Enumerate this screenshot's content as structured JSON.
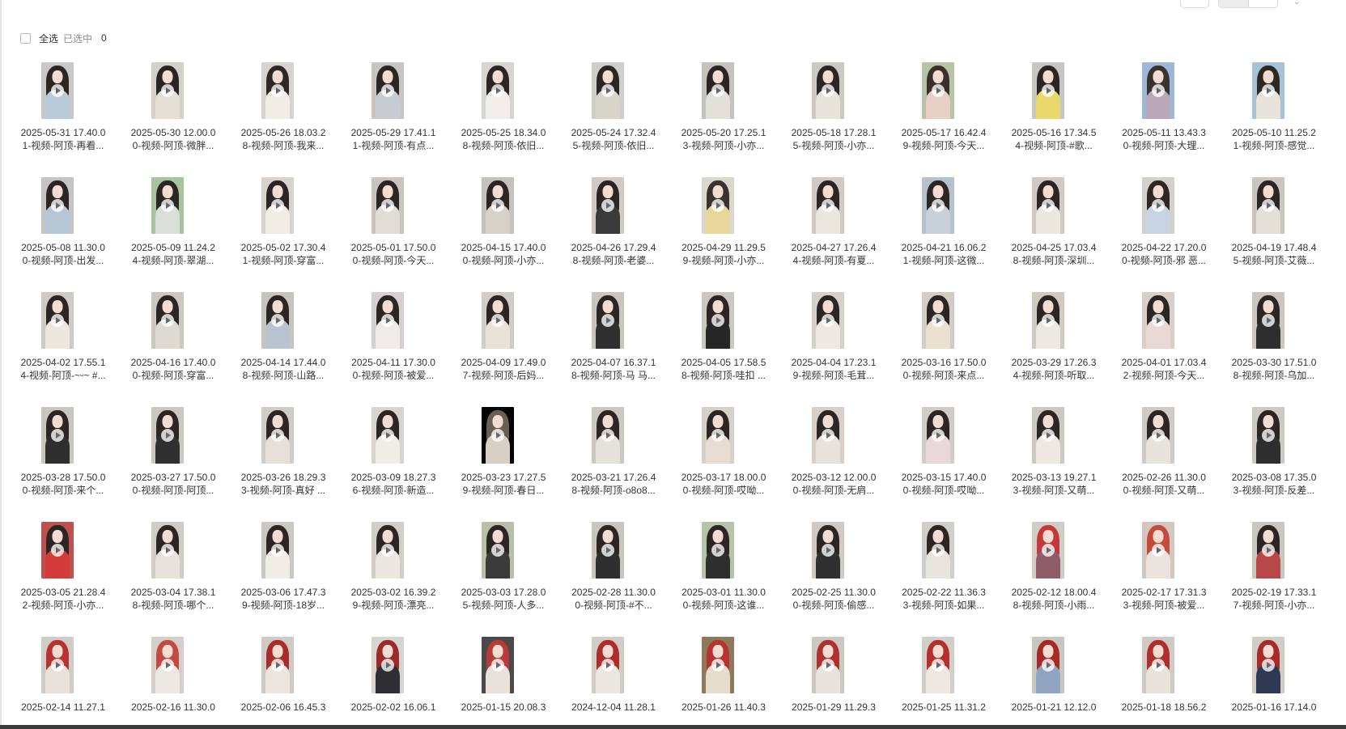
{
  "toolbar": {
    "select_all": "全选",
    "selected_label": "已选中",
    "selected_count": "0"
  },
  "items": [
    {
      "line1": "2025-05-31 17.40.0",
      "line2": "1-视频-阿顶-再看...",
      "bg": "#c8c8c8",
      "hair": "#2b2623",
      "body": "#b9cbd8"
    },
    {
      "line1": "2025-05-30 12.00.0",
      "line2": "0-视频-阿顶-微胖...",
      "bg": "#d5d1cb",
      "hair": "#2a2522",
      "body": "#e6dfd6"
    },
    {
      "line1": "2025-05-26 18.03.2",
      "line2": "8-视频-阿顶-我来...",
      "bg": "#d8d3cc",
      "hair": "#2e2824",
      "body": "#f0ece6"
    },
    {
      "line1": "2025-05-29 17.41.1",
      "line2": "1-视频-阿顶-有点...",
      "bg": "#c9c6c1",
      "hair": "#2b2623",
      "body": "#c7ccd2"
    },
    {
      "line1": "2025-05-25 18.34.0",
      "line2": "8-视频-阿顶-依旧...",
      "bg": "#d9d6d0",
      "hair": "#2b2623",
      "body": "#f2efea"
    },
    {
      "line1": "2025-05-24 17.32.4",
      "line2": "5-视频-阿顶-依旧...",
      "bg": "#cfcfc9",
      "hair": "#2b2623",
      "body": "#d8d4c8"
    },
    {
      "line1": "2025-05-20 17.25.1",
      "line2": "3-视频-阿顶-小亦...",
      "bg": "#c5c2bc",
      "hair": "#2a2522",
      "body": "#e3e0da"
    },
    {
      "line1": "2025-05-18 17.28.1",
      "line2": "5-视频-阿顶-小亦...",
      "bg": "#ccc9c3",
      "hair": "#2b2623",
      "body": "#e8e4dc"
    },
    {
      "line1": "2025-05-17 16.42.4",
      "line2": "9-视频-阿顶-今天...",
      "bg": "#b8c4a8",
      "hair": "#3a2f2a",
      "body": "#e6cfc4"
    },
    {
      "line1": "2025-05-16 17.34.5",
      "line2": "4-视频-阿顶-#歌...",
      "bg": "#c8c6c2",
      "hair": "#2b2623",
      "body": "#e8d96a"
    },
    {
      "line1": "2025-05-11 13.43.3",
      "line2": "0-视频-阿顶-大理...",
      "bg": "#9fb7d6",
      "hair": "#3a322d",
      "body": "#b8a8b8"
    },
    {
      "line1": "2025-05-10 11.25.2",
      "line2": "1-视频-阿顶-感觉...",
      "bg": "#a8c2d8",
      "hair": "#2e2824",
      "body": "#e8e4dc"
    },
    {
      "line1": "2025-05-08 11.30.0",
      "line2": "0-视频-阿顶-出发...",
      "bg": "#c4c4c4",
      "hair": "#2b2623",
      "body": "#b5c6d6"
    },
    {
      "line1": "2025-05-09 11.24.2",
      "line2": "4-视频-阿顶-翠湖...",
      "bg": "#a7c3a0",
      "hair": "#2b2623",
      "body": "#d8e0d8"
    },
    {
      "line1": "2025-05-02 17.30.4",
      "line2": "1-视频-阿顶-穿富...",
      "bg": "#d8d3cc",
      "hair": "#2b2623",
      "body": "#f0ece6"
    },
    {
      "line1": "2025-05-01 17.50.0",
      "line2": "0-视频-阿顶-今天...",
      "bg": "#c8c5be",
      "hair": "#2b2623",
      "body": "#e0ddd6"
    },
    {
      "line1": "2025-04-15 17.40.0",
      "line2": "0-视频-阿顶-小亦...",
      "bg": "#c4c2bc",
      "hair": "#2b2623",
      "body": "#d6d2c8"
    },
    {
      "line1": "2025-04-26 17.29.4",
      "line2": "8-视频-阿顶-老婆...",
      "bg": "#cfcbc4",
      "hair": "#2b2623",
      "body": "#3a3a3a"
    },
    {
      "line1": "2025-04-29 11.29.5",
      "line2": "9-视频-阿顶-小亦...",
      "bg": "#d8d8cc",
      "hair": "#3a322d",
      "body": "#e8d79a"
    },
    {
      "line1": "2025-04-27 17.26.4",
      "line2": "4-视频-阿顶-有夏...",
      "bg": "#cfcbc4",
      "hair": "#2b2623",
      "body": "#ebe6de"
    },
    {
      "line1": "2025-04-21 16.06.2",
      "line2": "1-视频-阿顶-这微...",
      "bg": "#b7c1cc",
      "hair": "#2b2623",
      "body": "#c8d0da"
    },
    {
      "line1": "2025-04-25 17.03.4",
      "line2": "8-视频-阿顶-深圳...",
      "bg": "#cfcbc4",
      "hair": "#2b2623",
      "body": "#ece8e0"
    },
    {
      "line1": "2025-04-22 17.20.0",
      "line2": "0-视频-阿顶-邪 恶...",
      "bg": "#d2d0ca",
      "hair": "#2e2824",
      "body": "#c8d4e4"
    },
    {
      "line1": "2025-04-19 17.48.4",
      "line2": "5-视频-阿顶-艾薇...",
      "bg": "#c9c6c0",
      "hair": "#2b2623",
      "body": "#e4e0d8"
    },
    {
      "line1": "2025-04-02 17.55.1",
      "line2": "4-视频-阿顶-~ᵕ~ #...",
      "bg": "#cfcbc4",
      "hair": "#2b2623",
      "body": "#ece8e0"
    },
    {
      "line1": "2025-04-16 17.40.0",
      "line2": "0-视频-阿顶-穿富...",
      "bg": "#cbc8c2",
      "hair": "#2b2623",
      "body": "#dedad2"
    },
    {
      "line1": "2025-04-14 17.44.0",
      "line2": "8-视频-阿顶-山路...",
      "bg": "#c6c4be",
      "hair": "#2b2623",
      "body": "#b8c4d0"
    },
    {
      "line1": "2025-04-11 17.30.0",
      "line2": "0-视频-阿顶-被爱...",
      "bg": "#d8cfd0",
      "hair": "#2b2623",
      "body": "#f0ebe6"
    },
    {
      "line1": "2025-04-09 17.49.0",
      "line2": "7-视频-阿顶-后妈...",
      "bg": "#d0ccc6",
      "hair": "#2b2623",
      "body": "#e8e2d8"
    },
    {
      "line1": "2025-04-07 16.37.1",
      "line2": "8-视频-阿顶-马 马...",
      "bg": "#c9c6c0",
      "hair": "#2b2623",
      "body": "#2f2f2f"
    },
    {
      "line1": "2025-04-05 17.58.5",
      "line2": "8-视频-阿顶-哇扣 ...",
      "bg": "#cbc8c2",
      "hair": "#2b2623",
      "body": "#262626"
    },
    {
      "line1": "2025-04-04 17.23.1",
      "line2": "9-视频-阿顶-毛茸...",
      "bg": "#d4d0ca",
      "hair": "#2b2623",
      "body": "#efe8e2"
    },
    {
      "line1": "2025-03-16 17.50.0",
      "line2": "0-视频-阿顶-来点...",
      "bg": "#d2ccc4",
      "hair": "#2b2623",
      "body": "#ece0d0"
    },
    {
      "line1": "2025-03-29 17.26.3",
      "line2": "4-视频-阿顶-听取...",
      "bg": "#cfcac2",
      "hair": "#2b2623",
      "body": "#eee8e2"
    },
    {
      "line1": "2025-04-01 17.03.4",
      "line2": "2-视频-阿顶-今天...",
      "bg": "#d8cfc8",
      "hair": "#2b2623",
      "body": "#ead8d4"
    },
    {
      "line1": "2025-03-30 17.51.0",
      "line2": "8-视频-阿顶-乌加...",
      "bg": "#cbc7c0",
      "hair": "#2b2623",
      "body": "#2e2e2e"
    },
    {
      "line1": "2025-03-28 17.50.0",
      "line2": "0-视频-阿顶-来个...",
      "bg": "#c9c6c0",
      "hair": "#2b2623",
      "body": "#2e2e2e"
    },
    {
      "line1": "2025-03-27 17.50.0",
      "line2": "0-视频-阿顶-阿顶...",
      "bg": "#cbc8c2",
      "hair": "#2b2623",
      "body": "#303030"
    },
    {
      "line1": "2025-03-26 18.29.3",
      "line2": "3-视频-阿顶-真好 ...",
      "bg": "#d0ccc6",
      "hair": "#2b2623",
      "body": "#e6e0d8"
    },
    {
      "line1": "2025-03-09 18.27.3",
      "line2": "6-视频-阿顶-新造...",
      "bg": "#d8d4cf",
      "hair": "#2b2623",
      "body": "#f0ece6"
    },
    {
      "line1": "2025-03-23 17.27.5",
      "line2": "9-视频-阿顶-春日...",
      "bg": "#050505",
      "hair": "#6b5f55",
      "body": "#d8d0c4"
    },
    {
      "line1": "2025-03-21 17.26.4",
      "line2": "8-视频-阿顶-o8o8...",
      "bg": "#cbc8c2",
      "hair": "#2b2623",
      "body": "#e6e2da"
    },
    {
      "line1": "2025-03-17 18.00.0",
      "line2": "0-视频-阿顶-哎呦...",
      "bg": "#d6d0c8",
      "hair": "#2b2623",
      "body": "#e8dcd0"
    },
    {
      "line1": "2025-03-12 12.00.0",
      "line2": "0-视频-阿顶-无肩...",
      "bg": "#d8cfc8",
      "hair": "#2b2623",
      "body": "#e8e2dc"
    },
    {
      "line1": "2025-03-15 17.40.0",
      "line2": "0-视频-阿顶-哎呦...",
      "bg": "#d2ccc6",
      "hair": "#2b2623",
      "body": "#ead8d8"
    },
    {
      "line1": "2025-03-13 19.27.1",
      "line2": "3-视频-阿顶-又萌...",
      "bg": "#ccc8c2",
      "hair": "#2b2623",
      "body": "#eee8e0"
    },
    {
      "line1": "2025-02-26 11.30.0",
      "line2": "0-视频-阿顶-又萌...",
      "bg": "#cfcbc4",
      "hair": "#2b2623",
      "body": "#e8e4dc"
    },
    {
      "line1": "2025-03-08 17.35.0",
      "line2": "3-视频-阿顶-反差...",
      "bg": "#cdcac4",
      "hair": "#2b2623",
      "body": "#2e2e2e"
    },
    {
      "line1": "2025-03-05 21.28.4",
      "line2": "2-视频-阿顶-小亦...",
      "bg": "#c05050",
      "hair": "#2b2623",
      "body": "#d43a3a"
    },
    {
      "line1": "2025-03-04 17.38.1",
      "line2": "8-视频-阿顶-哪个...",
      "bg": "#d0ccc6",
      "hair": "#2b2623",
      "body": "#e8e2da"
    },
    {
      "line1": "2025-03-06 17.47.3",
      "line2": "9-视频-阿顶-18岁...",
      "bg": "#cbc8c2",
      "hair": "#2b2623",
      "body": "#f0ece6"
    },
    {
      "line1": "2025-03-02 16.39.2",
      "line2": "9-视频-阿顶-漂亮...",
      "bg": "#d2cec8",
      "hair": "#2b2623",
      "body": "#ece8e0"
    },
    {
      "line1": "2025-03-03 17.28.0",
      "line2": "5-视频-阿顶-人多...",
      "bg": "#b8c0a8",
      "hair": "#2b2623",
      "body": "#3a3a3a"
    },
    {
      "line1": "2025-02-28 11.30.0",
      "line2": "0-视频-阿顶-#不...",
      "bg": "#c9c6c0",
      "hair": "#2b2623",
      "body": "#2e2e2e"
    },
    {
      "line1": "2025-03-01 11.30.0",
      "line2": "0-视频-阿顶-这谁...",
      "bg": "#b8c4a8",
      "hair": "#2b2623",
      "body": "#2e2e2e"
    },
    {
      "line1": "2025-02-25 11.30.0",
      "line2": "0-视频-阿顶-偷感...",
      "bg": "#cfcbc4",
      "hair": "#2b2623",
      "body": "#303030"
    },
    {
      "line1": "2025-02-22 11.36.3",
      "line2": "3-视频-阿顶-如果...",
      "bg": "#d2ceca",
      "hair": "#2b2623",
      "body": "#e8e4de"
    },
    {
      "line1": "2025-02-12 18.00.4",
      "line2": "8-视频-阿顶-小雨...",
      "bg": "#d0ccc6",
      "hair": "#c43838",
      "body": "#8f5c6a"
    },
    {
      "line1": "2025-02-17 17.31.3",
      "line2": "3-视频-阿顶-被爱...",
      "bg": "#d2c8c0",
      "hair": "#c44a3a",
      "body": "#ece4dc"
    },
    {
      "line1": "2025-02-19 17.33.1",
      "line2": "7-视频-阿顶-小亦...",
      "bg": "#c8c8c0",
      "hair": "#2b2623",
      "body": "#b84848"
    },
    {
      "line1": "2025-02-14 11.27.1",
      "line2": "",
      "bg": "#d0ccc6",
      "hair": "#b83232",
      "body": "#e8e2da"
    },
    {
      "line1": "2025-02-16 11.30.0",
      "line2": "",
      "bg": "#d6ceca",
      "hair": "#c24a44",
      "body": "#eee8e2"
    },
    {
      "line1": "2025-02-06 16.45.3",
      "line2": "",
      "bg": "#cfcbc4",
      "hair": "#a82c2c",
      "body": "#ece6de"
    },
    {
      "line1": "2025-02-02 16.06.1",
      "line2": "",
      "bg": "#d8d4d0",
      "hair": "#9c2a2a",
      "body": "#2e2e34"
    },
    {
      "line1": "2025-01-15 20.08.3",
      "line2": "",
      "bg": "#4a4a4a",
      "hair": "#b83a3a",
      "body": "#e8e2da"
    },
    {
      "line1": "2024-12-04 11.28.1",
      "line2": "",
      "bg": "#d0ccc6",
      "hair": "#b02c2c",
      "body": "#ece8e0"
    },
    {
      "line1": "2025-01-26 11.40.3",
      "line2": "",
      "bg": "#8c7a5a",
      "hair": "#b83232",
      "body": "#e6dccc"
    },
    {
      "line1": "2025-01-29 11.29.3",
      "line2": "",
      "bg": "#cbc8c2",
      "hair": "#b03030",
      "body": "#e8e4dc"
    },
    {
      "line1": "2025-01-25 11.31.2",
      "line2": "",
      "bg": "#d2cec8",
      "hair": "#b82e2e",
      "body": "#ede8e2"
    },
    {
      "line1": "2025-01-21 12.12.0",
      "line2": "",
      "bg": "#c8c6c0",
      "hair": "#a82828",
      "body": "#8fa4c0"
    },
    {
      "line1": "2025-01-18 18.56.2",
      "line2": "",
      "bg": "#cfcbc4",
      "hair": "#b02e2e",
      "body": "#e8e4dc"
    },
    {
      "line1": "2025-01-16 17.14.0",
      "line2": "",
      "bg": "#d0ccc6",
      "hair": "#a82a2a",
      "body": "#2e3a54"
    }
  ]
}
